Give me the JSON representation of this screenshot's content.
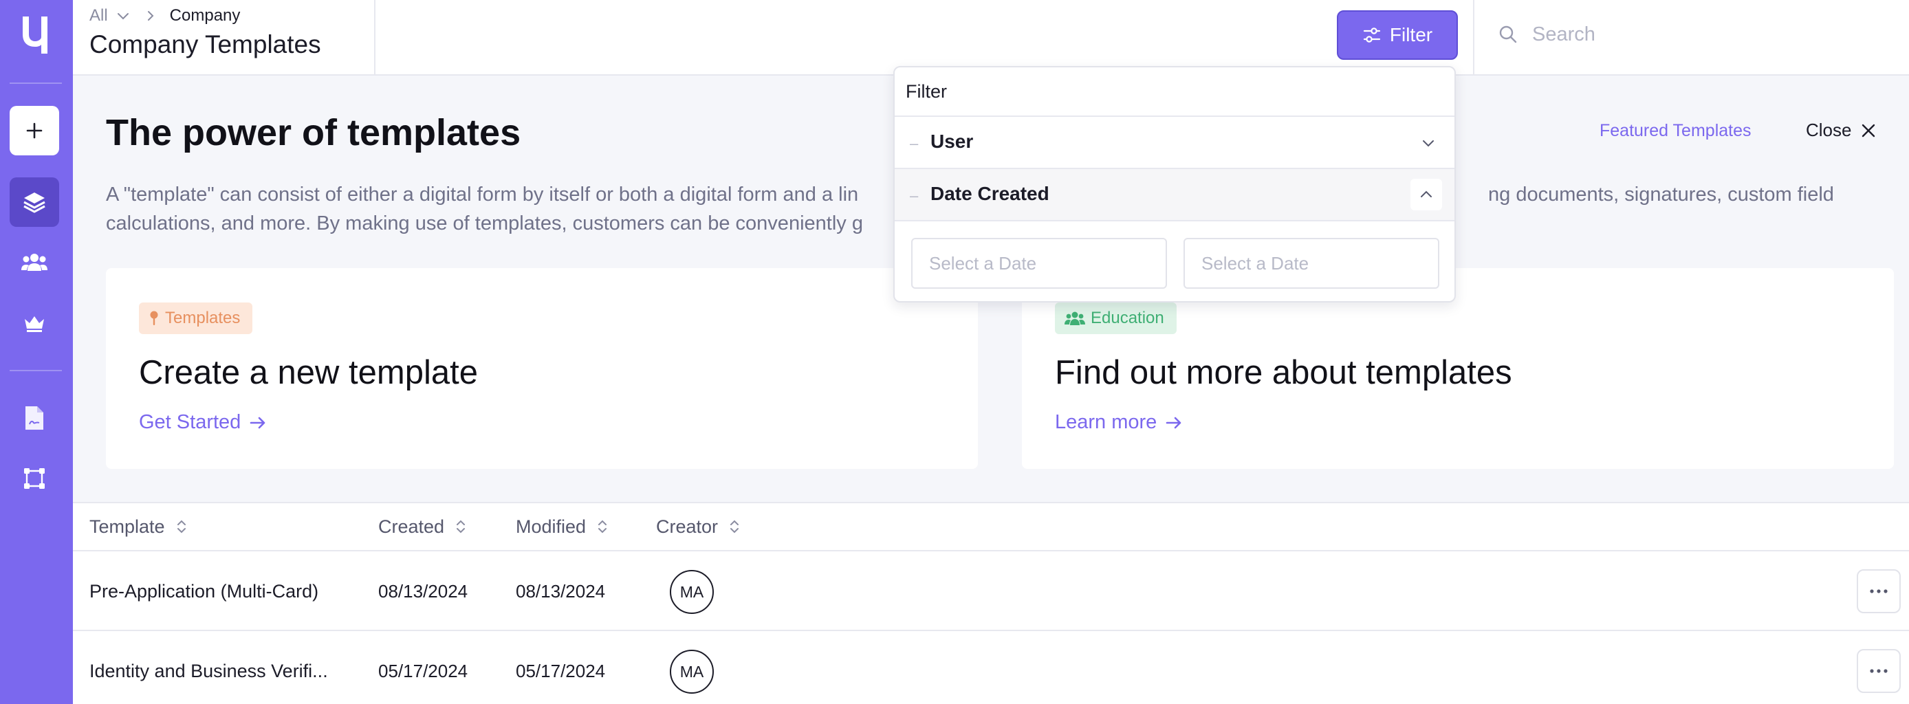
{
  "colors": {
    "brand": "#7b68ee",
    "sidebar_active": "#5b49c9",
    "templates_badge": "#fde7da",
    "education_badge": "#dff3e7"
  },
  "breadcrumb": {
    "root": "All",
    "current": "Company"
  },
  "page": {
    "title": "Company Templates"
  },
  "header": {
    "filter_label": "Filter",
    "search_placeholder": "Search"
  },
  "sidebar": {
    "items": [
      {
        "icon": "plus-icon"
      },
      {
        "icon": "layers-icon"
      },
      {
        "icon": "users-icon"
      },
      {
        "icon": "crown-icon"
      },
      {
        "icon": "document-icon"
      },
      {
        "icon": "workflow-icon"
      }
    ]
  },
  "hero": {
    "title": "The power of templates",
    "desc_line1_a": "A \"template\" can consist of either a digital form by itself or both a digital form and a lin",
    "desc_line1_b": "ng documents, signatures, custom field",
    "desc_line2": "calculations, and more. By making use of templates, customers can be conveniently g",
    "featured_link": "Featured Templates",
    "close_label": "Close"
  },
  "cards": [
    {
      "badge": "Templates",
      "title": "Create a new template",
      "link": "Get Started"
    },
    {
      "badge": "Education",
      "title": "Find out more about templates",
      "link": "Learn more"
    }
  ],
  "table": {
    "columns": [
      "Template",
      "Created",
      "Modified",
      "Creator"
    ],
    "rows": [
      {
        "name": "Pre-Application (Multi-Card)",
        "created": "08/13/2024",
        "modified": "08/13/2024",
        "creator": "MA"
      },
      {
        "name": "Identity and Business Verifi...",
        "created": "05/17/2024",
        "modified": "05/17/2024",
        "creator": "MA"
      }
    ]
  },
  "filter_dropdown": {
    "title": "Filter",
    "sections": [
      {
        "label": "User",
        "expanded": false
      },
      {
        "label": "Date Created",
        "expanded": true
      }
    ],
    "date_from_placeholder": "Select a Date",
    "date_to_placeholder": "Select a Date"
  }
}
